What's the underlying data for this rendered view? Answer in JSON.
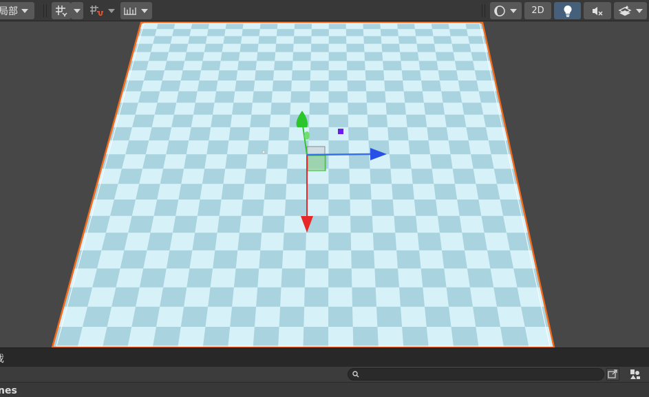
{
  "toolbar": {
    "pivot_label": "局部",
    "mode_2d_label": "2D"
  },
  "bottom_panel": {
    "tab_label": "戏",
    "search_placeholder": "",
    "folder_label": "nes"
  },
  "icons": {
    "grid": "grid-snap-icon",
    "snap": "increment-snap-icon",
    "ruler": "ruler-icon",
    "shading": "shading-mode-icon",
    "light": "lighting-bulb-icon",
    "audio": "audio-mute-icon",
    "effects": "effects-layers-icon",
    "search": "search-icon",
    "expand": "expand-window-icon",
    "filter": "filter-type-icon"
  },
  "colors": {
    "toolbar_bg": "#383838",
    "button_bg": "#585858",
    "active_button": "#46607c",
    "viewport_bg": "#474747",
    "plane_light": "#d7f1f9",
    "plane_dark": "#a9d3de",
    "selection_outline": "#f26b1d",
    "axis_red": "#e62828",
    "axis_green": "#2cc52c",
    "axis_blue": "#2650e6"
  }
}
